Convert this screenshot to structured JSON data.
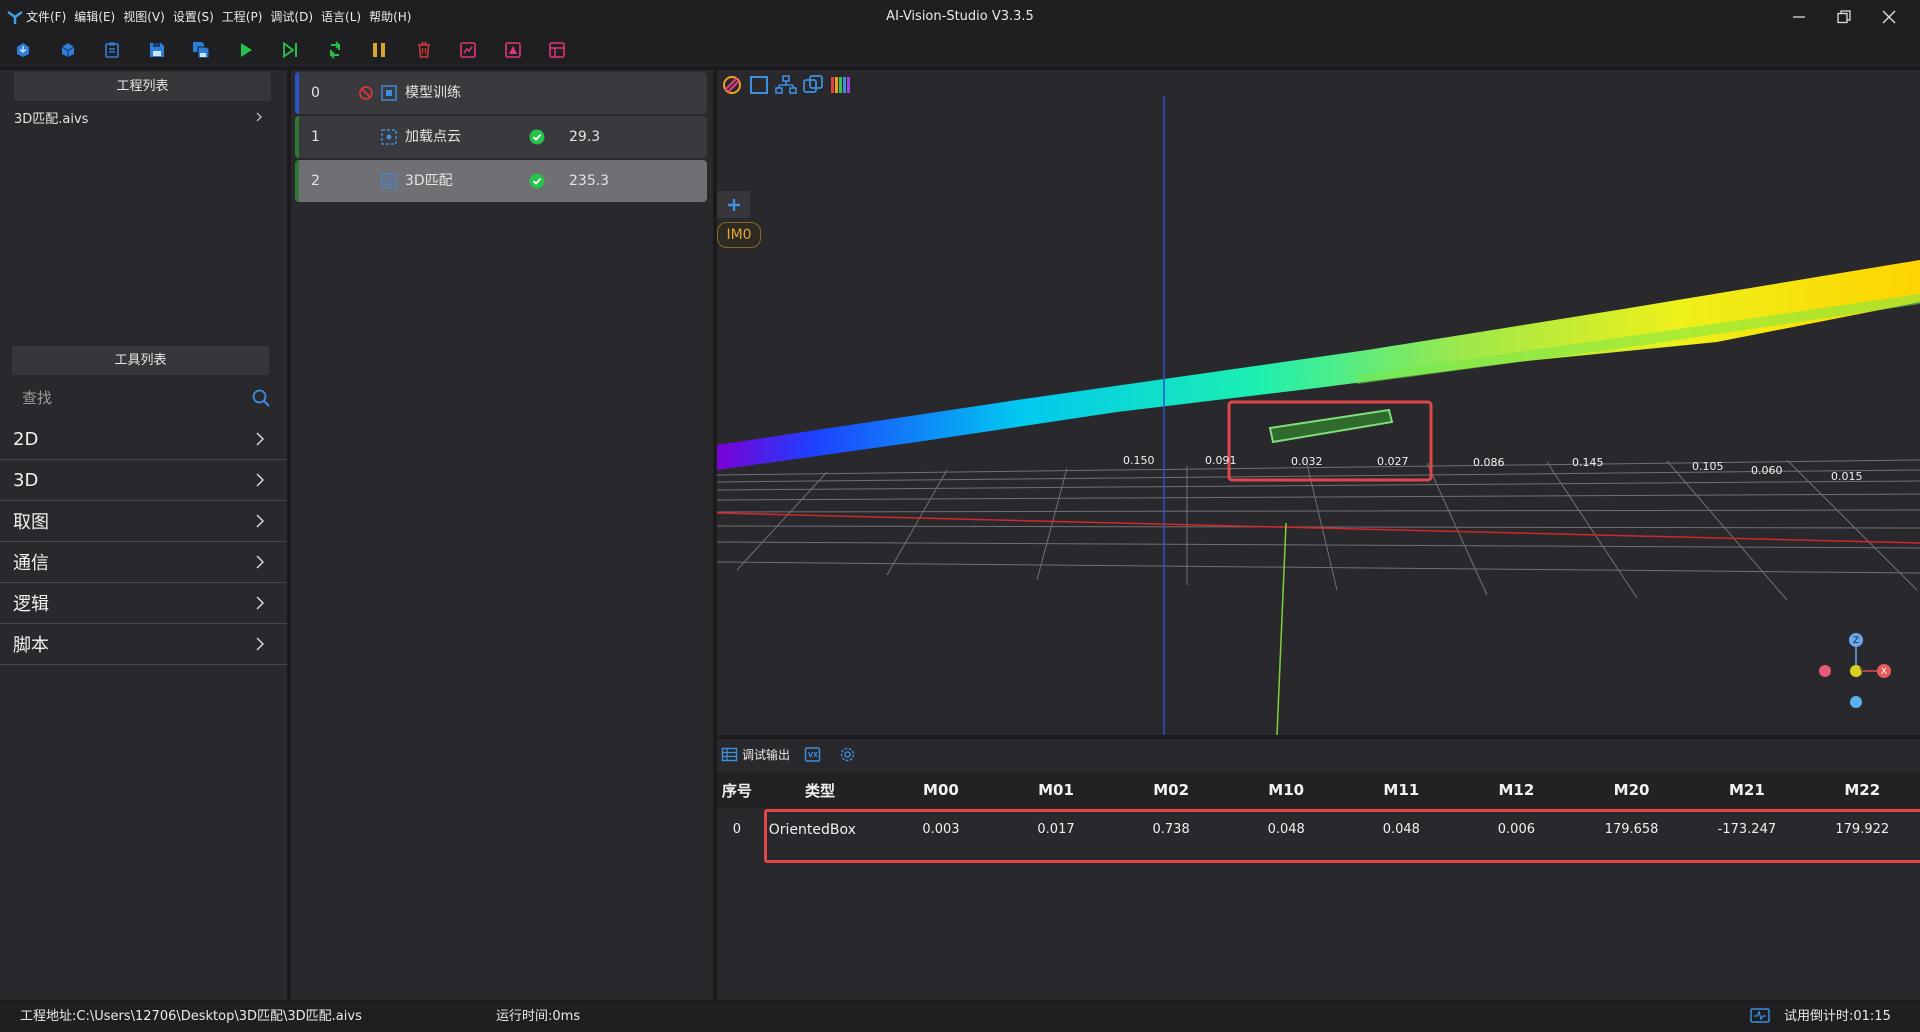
{
  "app": {
    "title": "AI-Vision-Studio V3.3.5",
    "menus": [
      "文件(F)",
      "编辑(E)",
      "视图(V)",
      "设置(S)",
      "工程(P)",
      "调试(D)",
      "语言(L)",
      "帮助(H)"
    ]
  },
  "toolbar": {
    "icons": [
      "import-icon",
      "export-icon",
      "clipboard-icon",
      "save-icon",
      "save-as-icon",
      "run-icon",
      "step-run-icon",
      "loop-run-icon",
      "pause-icon",
      "delete-icon",
      "panel-icon",
      "image-icon",
      "layout-icon"
    ]
  },
  "left": {
    "project_header": "工程列表",
    "project_item": "3D匹配.aivs",
    "tools_header": "工具列表",
    "search_placeholder": "查找",
    "categories": [
      "2D",
      "3D",
      "取图",
      "通信",
      "逻辑",
      "脚本"
    ]
  },
  "flow": {
    "rows": [
      {
        "index": "0",
        "name": "模型训练",
        "time": "",
        "status": "disabled"
      },
      {
        "index": "1",
        "name": "加载点云",
        "time": "29.3",
        "status": "ok"
      },
      {
        "index": "2",
        "name": "3D匹配",
        "time": "235.3",
        "status": "ok"
      }
    ]
  },
  "viewport": {
    "image_badge": "IM0",
    "grid_labels": [
      "0.150",
      "0.091",
      "0.032",
      "0.027",
      "0.086",
      "0.145",
      "0.105",
      "0.060",
      "0.015"
    ],
    "axis_labels": [
      "Z",
      "Y",
      "X"
    ]
  },
  "output": {
    "tab_label": "调试输出",
    "columns": [
      "序号",
      "类型",
      "M00",
      "M01",
      "M02",
      "M10",
      "M11",
      "M12",
      "M20",
      "M21",
      "M22"
    ],
    "rows": [
      [
        "0",
        "OrientedBox",
        "0.003",
        "0.017",
        "0.738",
        "0.048",
        "0.048",
        "0.006",
        "179.658",
        "-173.247",
        "179.922"
      ]
    ]
  },
  "status": {
    "path": "工程地址:C:\\Users\\12706\\Desktop\\3D匹配\\3D匹配.aivs",
    "runtime": "运行时间:0ms",
    "trial": "试用倒计时:01:15"
  },
  "colors": {
    "accent_blue": "#2f7fd8",
    "ok_green": "#27c24c",
    "highlight_red": "#e0474a",
    "badge_orange": "#e0a53a"
  }
}
